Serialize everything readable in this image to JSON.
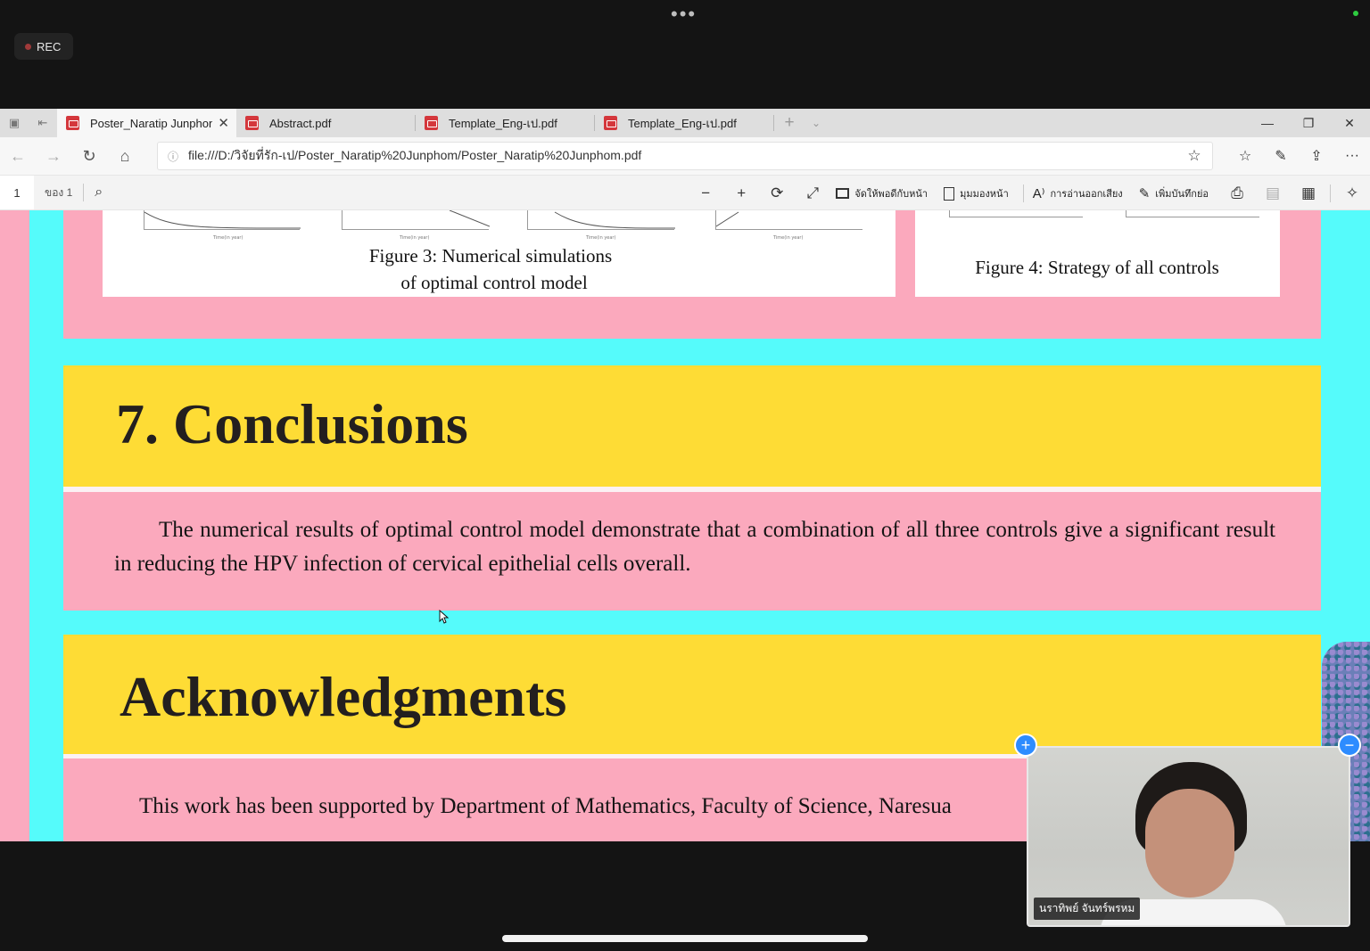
{
  "meeting": {
    "rec_label": "REC",
    "more_dots": "•••"
  },
  "tabs": [
    {
      "label": "Poster_Naratip Junphon",
      "active": true
    },
    {
      "label": "Abstract.pdf",
      "active": false
    },
    {
      "label": "Template_Eng-เป.pdf",
      "active": false
    },
    {
      "label": "Template_Eng-เป.pdf",
      "active": false
    }
  ],
  "address": {
    "url": "file:///D:/วิจัยที่รัก-เป/Poster_Naratip%20Junphom/Poster_Naratip%20Junphom.pdf"
  },
  "pdf_toolbar": {
    "page_number": "1",
    "page_of": "ของ 1",
    "fit_page_label": "จัดให้พอดีกับหน้า",
    "page_view_label": "มุมมองหน้า",
    "read_aloud_label": "การอ่านออกเสียง",
    "add_notes_label": "เพิ่มบันทึกย่อ"
  },
  "poster": {
    "figure3_caption_line1": "Figure 3: Numerical simulations",
    "figure3_caption_line2": "of optimal control model",
    "figure4_caption": "Figure 4: Strategy of all controls",
    "axis_label": "Time(in year)",
    "conclusions_heading": "7. Conclusions",
    "conclusions_text": "The numerical results of optimal control model demonstrate that a combination of all three controls give a significant result in reducing the HPV infection of cervical epithelial cells overall.",
    "ack_heading": "Acknowledgments",
    "ack_text": "This work has been supported by Department of Mathematics, Faculty of Science, Naresua"
  },
  "video": {
    "participant_name": "นราทิพย์ จันทร์พรหม"
  },
  "colors": {
    "poster_pink": "#fba9bd",
    "poster_cyan": "#55fbfb",
    "poster_yellow": "#fedc35",
    "zoom_blue": "#2d8cff"
  }
}
